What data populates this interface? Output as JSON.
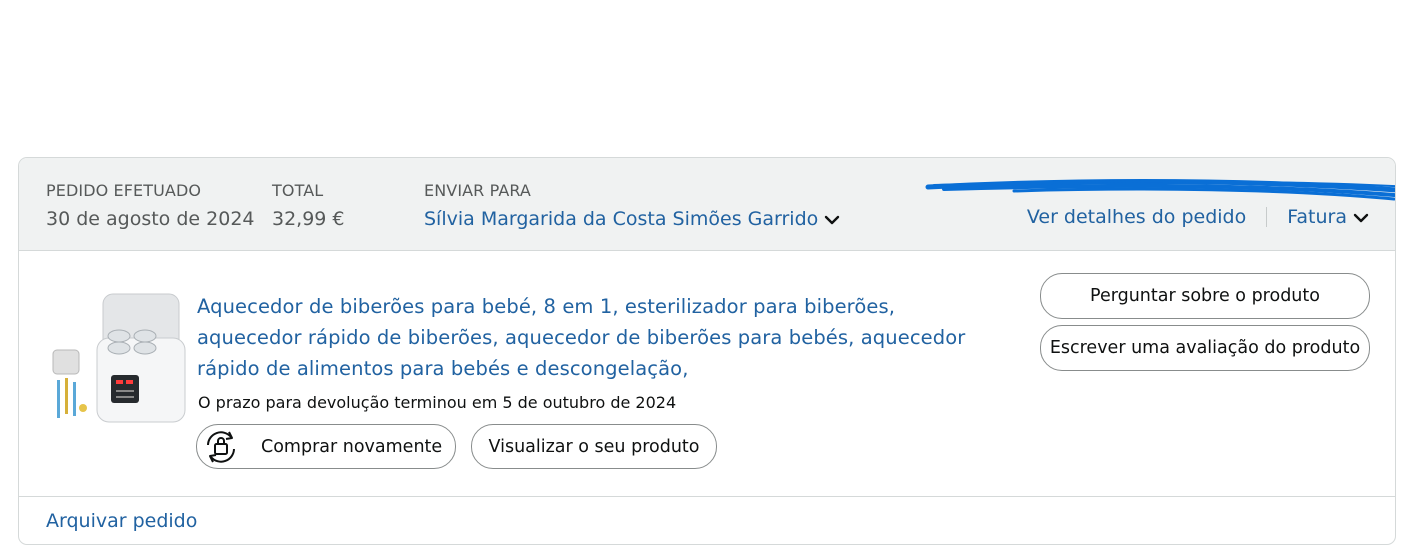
{
  "header": {
    "order_placed_label": "PEDIDO EFETUADO",
    "order_date": "30 de agosto de 2024",
    "total_label": "TOTAL",
    "total_value": "32,99 €",
    "ship_to_label": "ENVIAR PARA",
    "ship_to_name": "Sílvia Margarida da Costa Simões Garrido",
    "view_details_link": "Ver detalhes do pedido",
    "invoice_link": "Fatura"
  },
  "product": {
    "title": "Aquecedor de biberões para bebé, 8 em 1, esterilizador para biberões, aquecedor rápido de biberões, aquecedor de biberões para bebés, aquecedor rápido de alimentos para bebés e descongelação,",
    "return_status": "O prazo para devolução terminou em 5 de outubro de 2024",
    "buy_again_label": "Comprar novamente",
    "view_product_label": "Visualizar o seu produto"
  },
  "actions": {
    "ask_product_label": "Perguntar sobre o produto",
    "write_review_label": "Escrever uma avaliação do produto"
  },
  "footer": {
    "archive_label": "Arquivar pedido"
  },
  "colors": {
    "link": "#2162a1",
    "header_bg": "#f0f2f2",
    "redaction": "#0a6fd6"
  },
  "icons": [
    "chevron-down-icon",
    "buy-again-icon"
  ]
}
